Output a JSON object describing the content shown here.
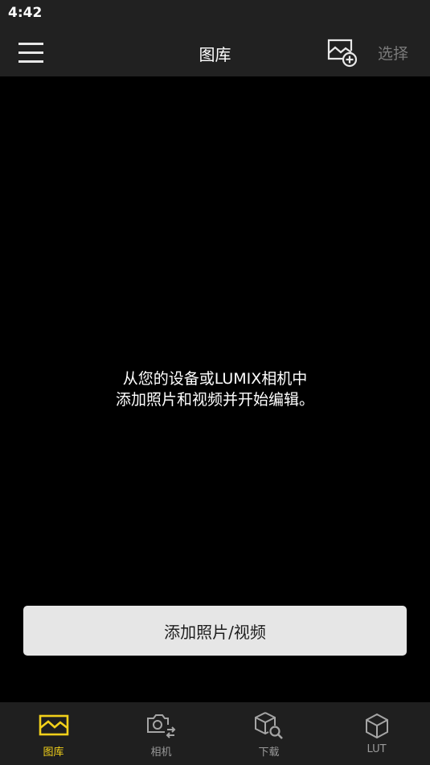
{
  "status_bar": {
    "time": "4:42"
  },
  "app_bar": {
    "title": "图库",
    "select_label": "选择"
  },
  "main": {
    "empty_line1": "从您的设备或LUMIX相机中",
    "empty_line2": "添加照片和视频并开始编辑。",
    "add_button_label": "添加照片/视频"
  },
  "bottom_nav": {
    "items": [
      {
        "label": "图库",
        "icon": "gallery-icon",
        "active": true
      },
      {
        "label": "相机",
        "icon": "camera-transfer-icon",
        "active": false
      },
      {
        "label": "下载",
        "icon": "cube-search-icon",
        "active": false
      },
      {
        "label": "LUT",
        "icon": "cube-icon",
        "active": false
      }
    ]
  },
  "colors": {
    "accent": "#f2d01a",
    "bar_background": "#212121",
    "inactive": "#9a9a9a",
    "disabled_text": "#7a7a7a",
    "button_background": "#e6e6e6"
  }
}
